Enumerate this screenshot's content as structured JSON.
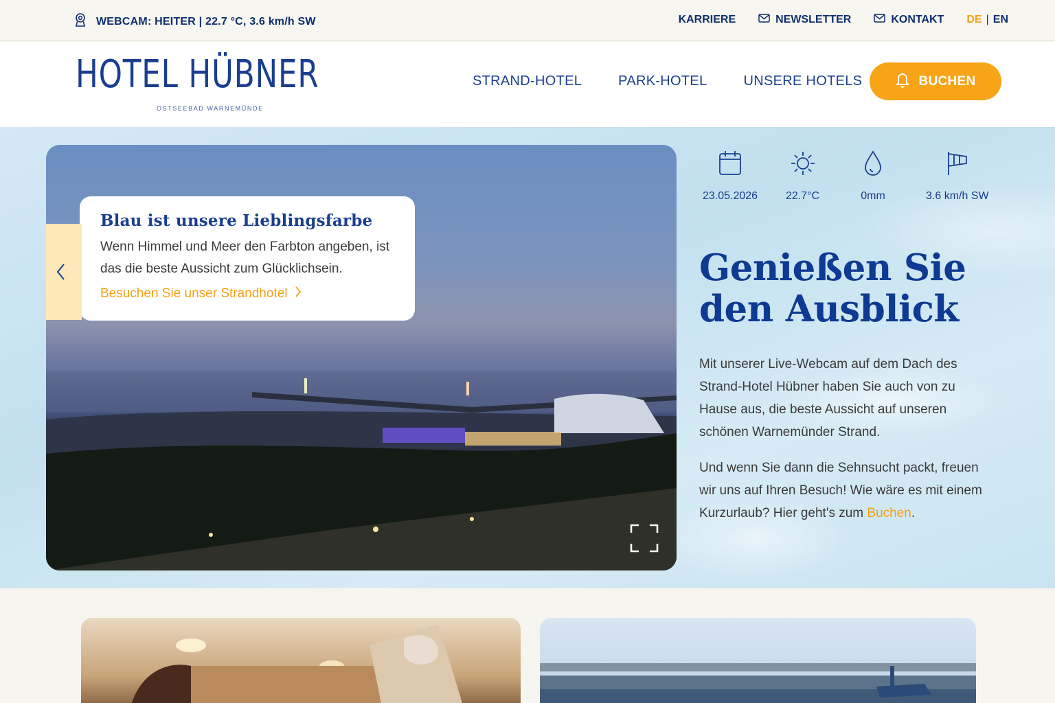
{
  "topbar": {
    "webcam_text": "WEBCAM: HEITER | 22.7 °C, 3.6 km/h SW",
    "links": {
      "karriere": "KARRIERE",
      "newsletter": "NEWSLETTER",
      "kontakt": "KONTAKT"
    },
    "lang_de": "DE",
    "lang_sep": "|",
    "lang_en": "EN"
  },
  "header": {
    "logo_name": "HOTEL HÜBNER",
    "logo_sub": "OSTSEEBAD WARNEMÜNDE",
    "nav": {
      "strand": "STRAND-HOTEL",
      "park": "PARK-HOTEL",
      "hotels": "UNSERE HOTELS"
    },
    "book_label": "BUCHEN"
  },
  "slider": {
    "caption_title": "Blau ist unsere Lieblingsfarbe",
    "caption_text": "Wenn Himmel und Meer den Farbton angeben, ist das die beste Aussicht zum Glücklichsein.",
    "caption_link": "Besuchen Sie unser Strandhotel"
  },
  "weather": {
    "date": "23.05.2026",
    "temp": "22.7°C",
    "rain": "0mm",
    "wind": "3.6 km/h SW"
  },
  "intro": {
    "heading": "Genießen Sie den Ausblick",
    "p1": "Mit unserer Live-Webcam auf dem Dach des Strand-Hotel Hübner haben Sie auch von zu Hause aus, die beste Aussicht auf unseren schönen Warnemünder Strand.",
    "p2_text": "Und wenn Sie dann die Sehnsucht packt, freuen wir uns auf Ihren Besuch! Wie wäre es mit einem Kurzurlaub? Hier geht's zum ",
    "p2_link": "Buchen",
    "p2_end": "."
  },
  "colors": {
    "brand_blue": "#1a3e8f",
    "accent_orange": "#f7a416",
    "hero_water": "#c9e4f1"
  }
}
